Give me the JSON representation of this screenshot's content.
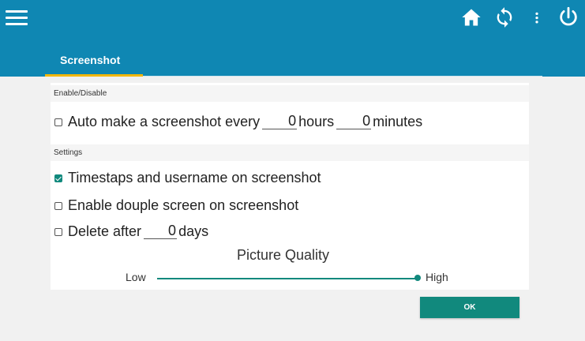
{
  "colors": {
    "topbar": "#0f87b3",
    "accent": "#11897d",
    "tab_indicator": "#f2b705"
  },
  "topbar": {
    "icons": [
      "menu-icon",
      "home-icon",
      "sync-icon",
      "more-vertical-icon",
      "power-icon"
    ]
  },
  "tabs": [
    {
      "label": "Screenshot",
      "active": true
    }
  ],
  "sections": {
    "enable_disable": {
      "header": "Enable/Disable",
      "auto_screenshot": {
        "checked": false,
        "label_prefix": "Auto make a screenshot every",
        "hours_value": "0",
        "hours_unit": "hours",
        "minutes_value": "0",
        "minutes_unit": "minutes"
      }
    },
    "settings": {
      "header": "Settings",
      "timestamps": {
        "checked": true,
        "label": "Timestaps and username on screenshot"
      },
      "double_screen": {
        "checked": false,
        "label": "Enable douple screen on screenshot"
      },
      "delete_after": {
        "checked": false,
        "label_prefix": "Delete after",
        "days_value": "0",
        "days_unit": "days"
      },
      "picture_quality": {
        "label": "Picture Quality",
        "low_label": "Low",
        "high_label": "High",
        "value": 1.0
      }
    }
  },
  "ok_button": {
    "label": "OK"
  }
}
